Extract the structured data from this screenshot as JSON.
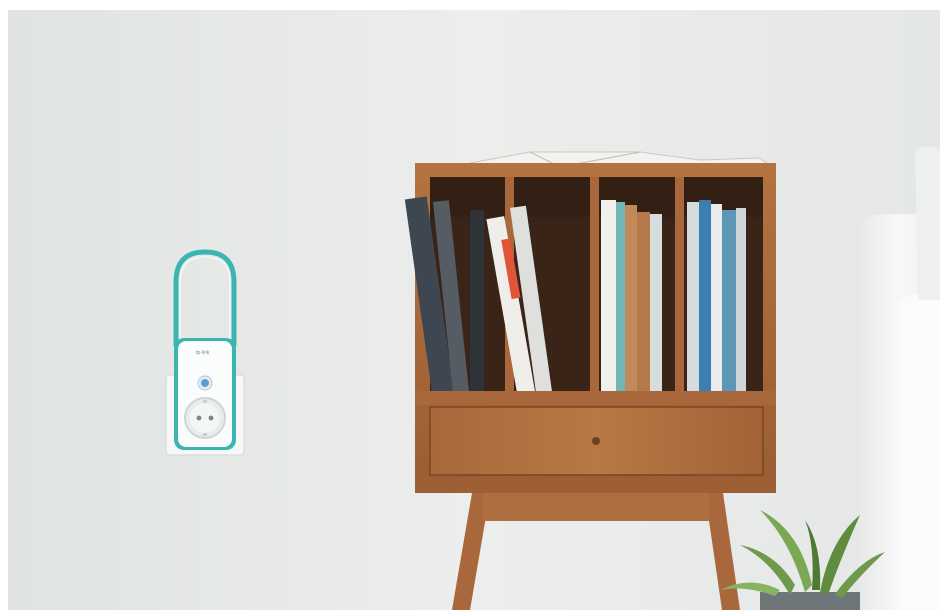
{
  "scene": {
    "description_free": true,
    "device": {
      "brand_logo": "tp-link",
      "accent_color": "#3ab5b0",
      "led_color": "#5a9fd4"
    },
    "colors": {
      "wall": "#e9eceb",
      "wood": "#a8683c",
      "wood_dark": "#7a4524",
      "shelf_inside": "#3a2418",
      "sofa": "#f4f5f4",
      "pot": "#6f767a",
      "plant": "#6e9a4a"
    }
  }
}
